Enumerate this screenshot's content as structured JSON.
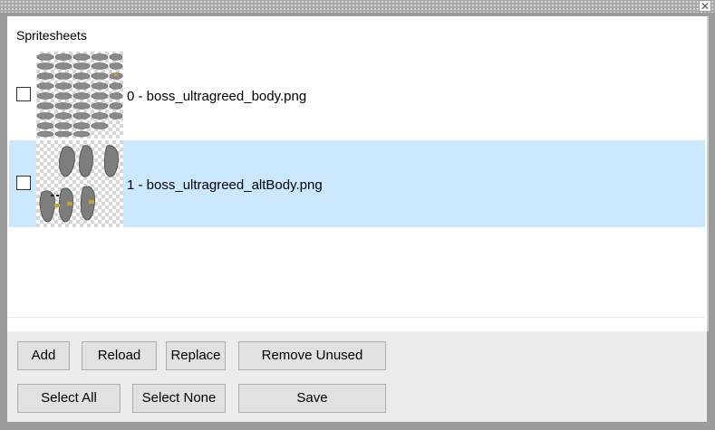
{
  "window": {
    "close_glyph": "✕"
  },
  "spritesheets": {
    "label": "Spritesheets",
    "items": [
      {
        "label": "0 - boss_ultragreed_body.png",
        "checked": false,
        "selected": false,
        "thumbnail": "boss-body-sprites"
      },
      {
        "label": "1 - boss_ultragreed_altBody.png",
        "checked": false,
        "selected": true,
        "thumbnail": "boss-altbody-sprites"
      }
    ]
  },
  "buttons": {
    "add": "Add",
    "reload": "Reload",
    "replace": "Replace",
    "remove_unused": "Remove Unused",
    "select_all": "Select All",
    "select_none": "Select None",
    "save": "Save"
  },
  "colors": {
    "selection": "#cce8ff",
    "frame": "#9b9b9b",
    "button_face": "#e1e1e1"
  }
}
